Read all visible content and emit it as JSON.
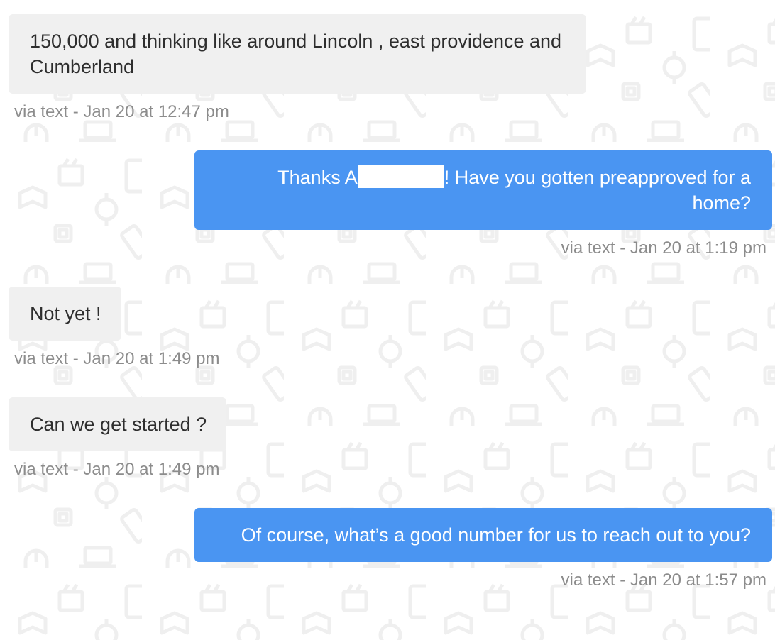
{
  "messages": [
    {
      "direction": "incoming",
      "text": "150,000 and thinking like around Lincoln , east providence and Cumberland",
      "meta": "via text - Jan 20 at 12:47 pm"
    },
    {
      "direction": "outgoing",
      "text_before_redaction": "Thanks A",
      "text_after_redaction": "! Have you gotten preapproved for a home?",
      "meta": "via text - Jan 20 at 1:19 pm"
    },
    {
      "direction": "incoming",
      "text": "Not yet !",
      "meta": "via text - Jan 20 at 1:49 pm"
    },
    {
      "direction": "incoming",
      "text": "Can we get started ?",
      "meta": "via text - Jan 20 at 1:49 pm"
    },
    {
      "direction": "outgoing",
      "text": "Of course, what’s a good number for us to reach out to you?",
      "meta": "via text - Jan 20 at 1:57 pm"
    }
  ],
  "colors": {
    "outgoing_bubble": "#4a95f2",
    "incoming_bubble": "#f0f0f0",
    "meta_text": "#8c8c8c",
    "background_pattern": "#f0f0f0"
  },
  "background_icons": [
    "laptop-icon",
    "mouse-icon",
    "tablet-icon",
    "phone-icon",
    "watch-icon",
    "chip-icon",
    "book-icon",
    "film-icon"
  ]
}
